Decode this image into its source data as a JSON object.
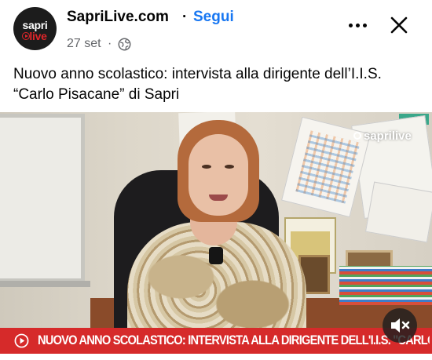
{
  "header": {
    "avatar_text_top": "sapri",
    "avatar_text_bottom": "live",
    "page_name": "SapriLive.com",
    "separator": "·",
    "follow_label": "Segui",
    "date": "27 set",
    "date_separator": "·",
    "audience_icon": "globe-icon",
    "more_icon": "more-horizontal-icon",
    "close_icon": "close-icon"
  },
  "post": {
    "text": "Nuovo anno scolastico: intervista alla dirigente dell’I.I.S. “Carlo Pisacane” di Sapri"
  },
  "video": {
    "watermark": "saprilive",
    "ticker_text": "NUOVO ANNO SCOLASTICO: INTERVISTA ALLA DIRIGENTE DELL'I.I.S. \"CARLO PISACANE\" DI SAPRI",
    "ticker_icon": "play-circle-icon",
    "mute_icon": "speaker-muted-icon"
  },
  "colors": {
    "link": "#1877f2",
    "ticker": "#d62a2a",
    "brand_red": "#e0262a"
  }
}
